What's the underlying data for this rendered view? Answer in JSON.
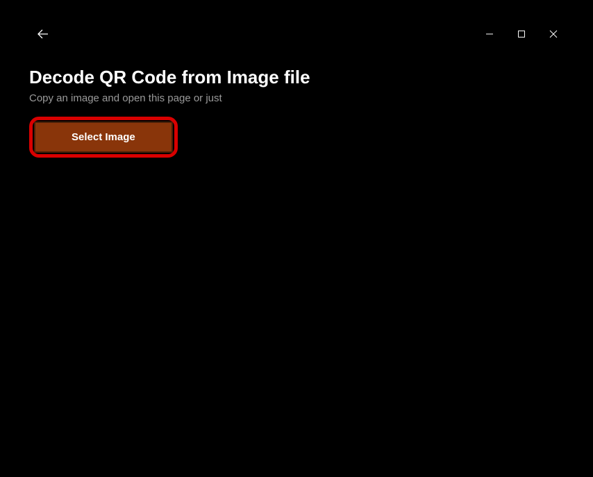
{
  "titlebar": {
    "back_icon": "back-arrow",
    "controls": {
      "minimize": "minimize",
      "maximize": "maximize",
      "close": "close"
    }
  },
  "page": {
    "title": "Decode QR Code from Image file",
    "subtitle": "Copy an image and open this page or just",
    "select_button_label": "Select Image"
  },
  "colors": {
    "accent": "#89350a",
    "highlight_border": "#d90000",
    "background": "#000000",
    "text": "#ffffff",
    "subtext": "#9a9a9a"
  }
}
